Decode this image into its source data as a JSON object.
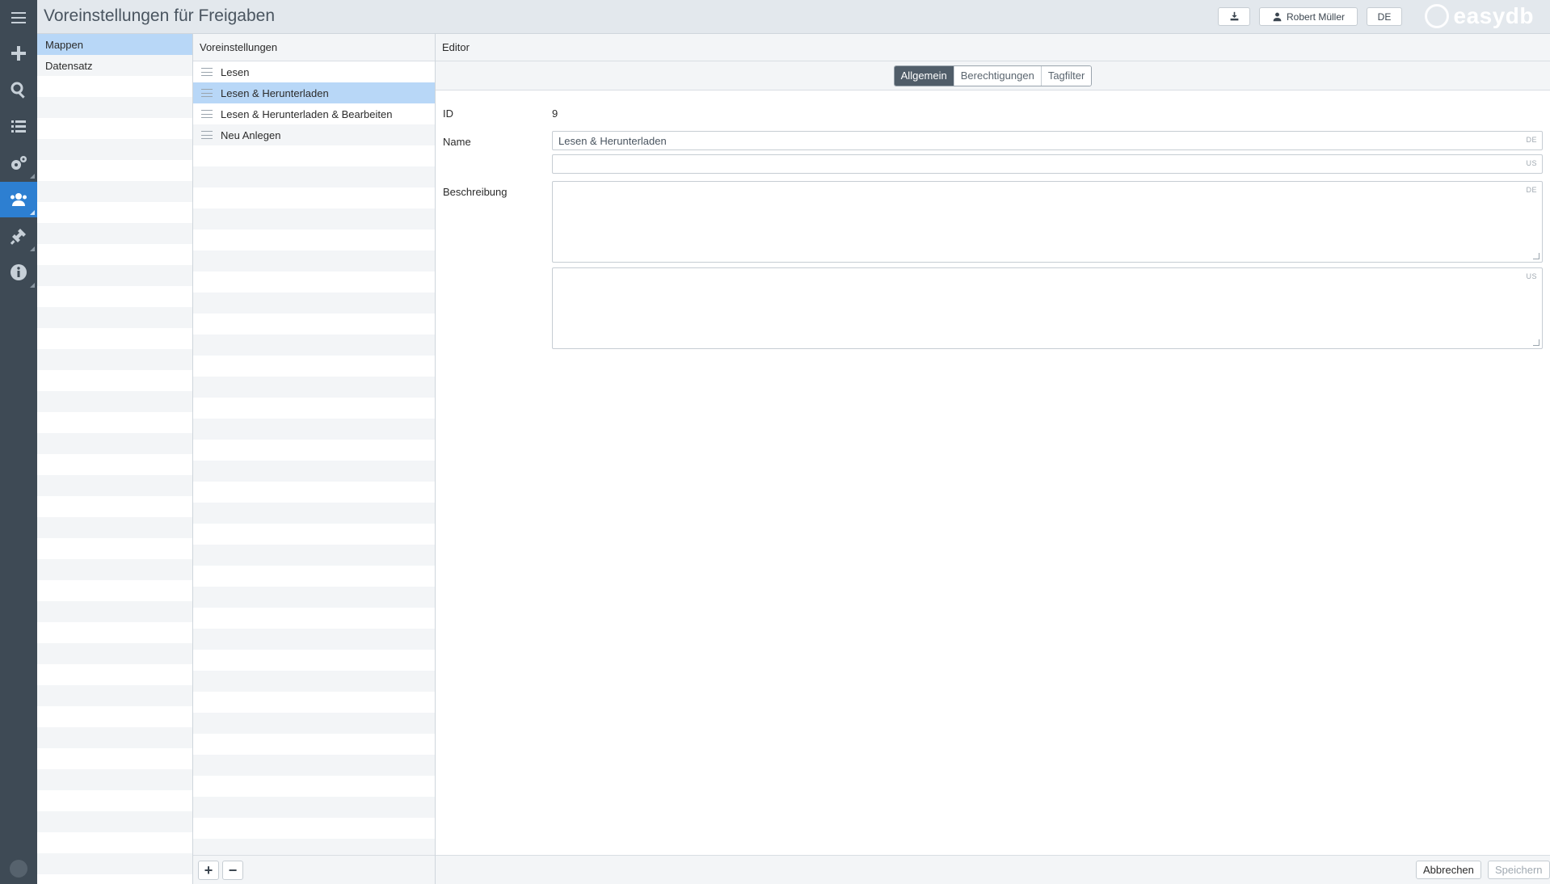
{
  "header": {
    "title": "Voreinstellungen für Freigaben",
    "user_label": "Robert Müller",
    "language_label": "DE",
    "logo_text": "easydb"
  },
  "rail": {
    "items": [
      {
        "name": "menu-icon"
      },
      {
        "name": "plus-icon"
      },
      {
        "name": "search-icon"
      },
      {
        "name": "list-icon"
      },
      {
        "name": "gears-icon"
      },
      {
        "name": "users-icon",
        "active": true
      },
      {
        "name": "plugin-icon"
      },
      {
        "name": "info-icon"
      }
    ]
  },
  "sidebar": {
    "items": [
      {
        "label": "Mappen",
        "selected": true
      },
      {
        "label": "Datensatz",
        "selected": false
      }
    ]
  },
  "presets": {
    "header": "Voreinstellungen",
    "items": [
      {
        "label": "Lesen",
        "selected": false
      },
      {
        "label": "Lesen & Herunterladen",
        "selected": true
      },
      {
        "label": "Lesen & Herunterladen & Bearbeiten",
        "selected": false
      },
      {
        "label": "Neu Anlegen",
        "selected": false
      }
    ],
    "add_label": "+",
    "remove_label": "−"
  },
  "editor": {
    "header": "Editor",
    "tabs": [
      {
        "label": "Allgemein",
        "active": true
      },
      {
        "label": "Berechtigungen",
        "active": false
      },
      {
        "label": "Tagfilter",
        "active": false
      }
    ],
    "id_label": "ID",
    "id_value": "9",
    "name_label": "Name",
    "name_de_value": "Lesen & Herunterladen",
    "name_us_value": "",
    "description_label": "Beschreibung",
    "lang_de": "DE",
    "lang_us": "US",
    "cancel_label": "Abbrechen",
    "save_label": "Speichern"
  },
  "colors": {
    "accent": "#2d7fd1",
    "selected_row": "#b8d7f7",
    "rail_bg": "#3e4a55",
    "active_tab": "#505d69"
  }
}
